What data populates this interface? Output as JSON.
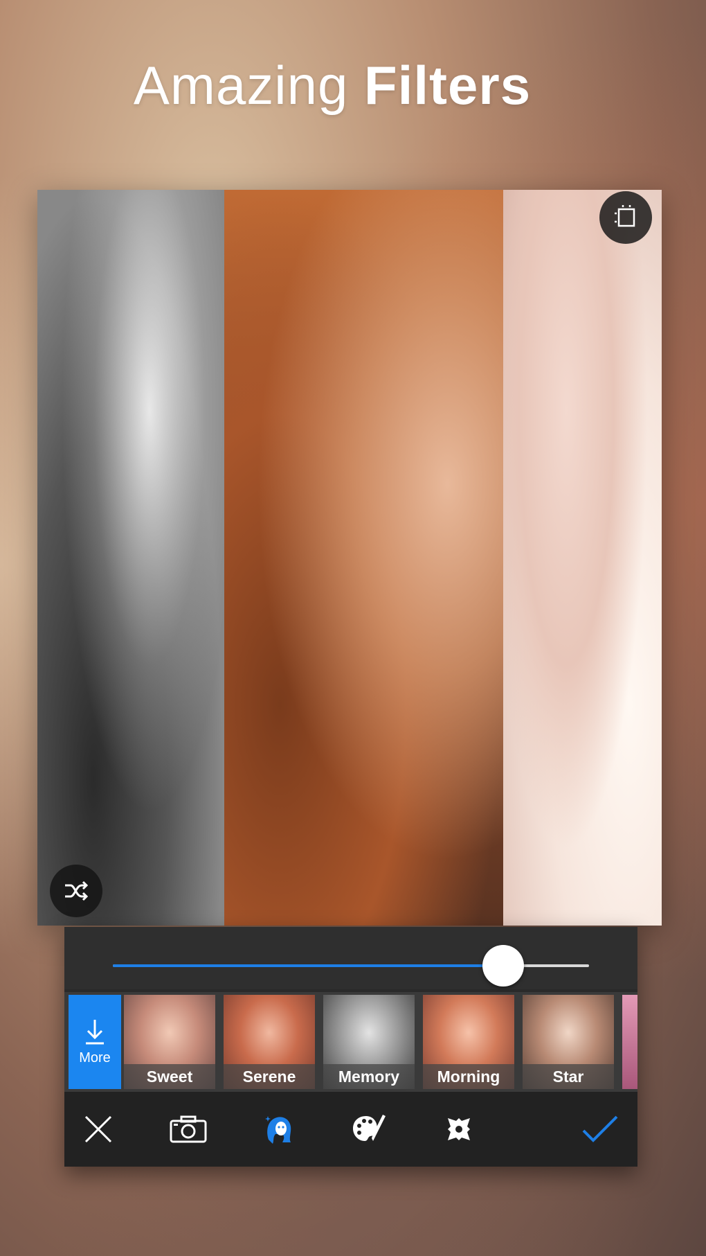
{
  "headline": {
    "light": "Amazing",
    "bold": "Filters"
  },
  "photo": {
    "crop_icon": "crop-icon",
    "shuffle_icon": "shuffle-icon"
  },
  "slider": {
    "value": 0.82,
    "fill_color": "#1e7fe6"
  },
  "filters": {
    "more_label": "More",
    "items": [
      {
        "name": "Sweet"
      },
      {
        "name": "Serene"
      },
      {
        "name": "Memory"
      },
      {
        "name": "Morning"
      },
      {
        "name": "Star"
      }
    ]
  },
  "toolbar": {
    "items": [
      "close-icon",
      "camera-icon",
      "face-filter-icon",
      "palette-icon",
      "frame-icon",
      "check-icon"
    ],
    "active": "face-filter-icon",
    "accent": "#1e7fe6"
  }
}
